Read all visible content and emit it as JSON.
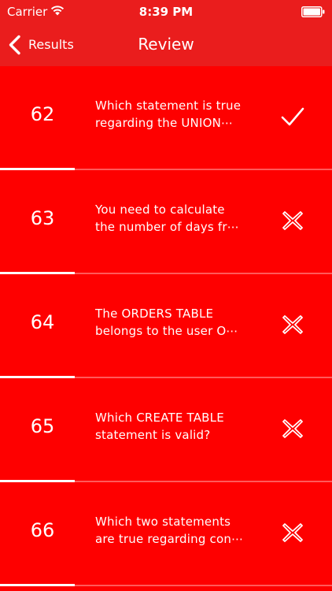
{
  "status_bar": {
    "carrier": "Carrier",
    "time": "8:39 PM"
  },
  "nav": {
    "back_label": "Results",
    "title": "Review"
  },
  "rows": [
    {
      "number": "62",
      "text": "Which statement is true\nregarding the UNION⋯",
      "result": "check-icon"
    },
    {
      "number": "63",
      "text": "You need to calculate\nthe number of days fr⋯",
      "result": "cross-icon"
    },
    {
      "number": "64",
      "text": "The ORDERS TABLE\nbelongs to the user O⋯",
      "result": "cross-icon"
    },
    {
      "number": "65",
      "text": "Which CREATE TABLE\nstatement is valid?",
      "result": "cross-icon"
    },
    {
      "number": "66",
      "text": "Which two statements\nare true regarding con⋯",
      "result": "cross-icon"
    }
  ],
  "colors": {
    "background": "#fe0000",
    "bar": "#ea1d1d",
    "text": "#ffffff"
  }
}
